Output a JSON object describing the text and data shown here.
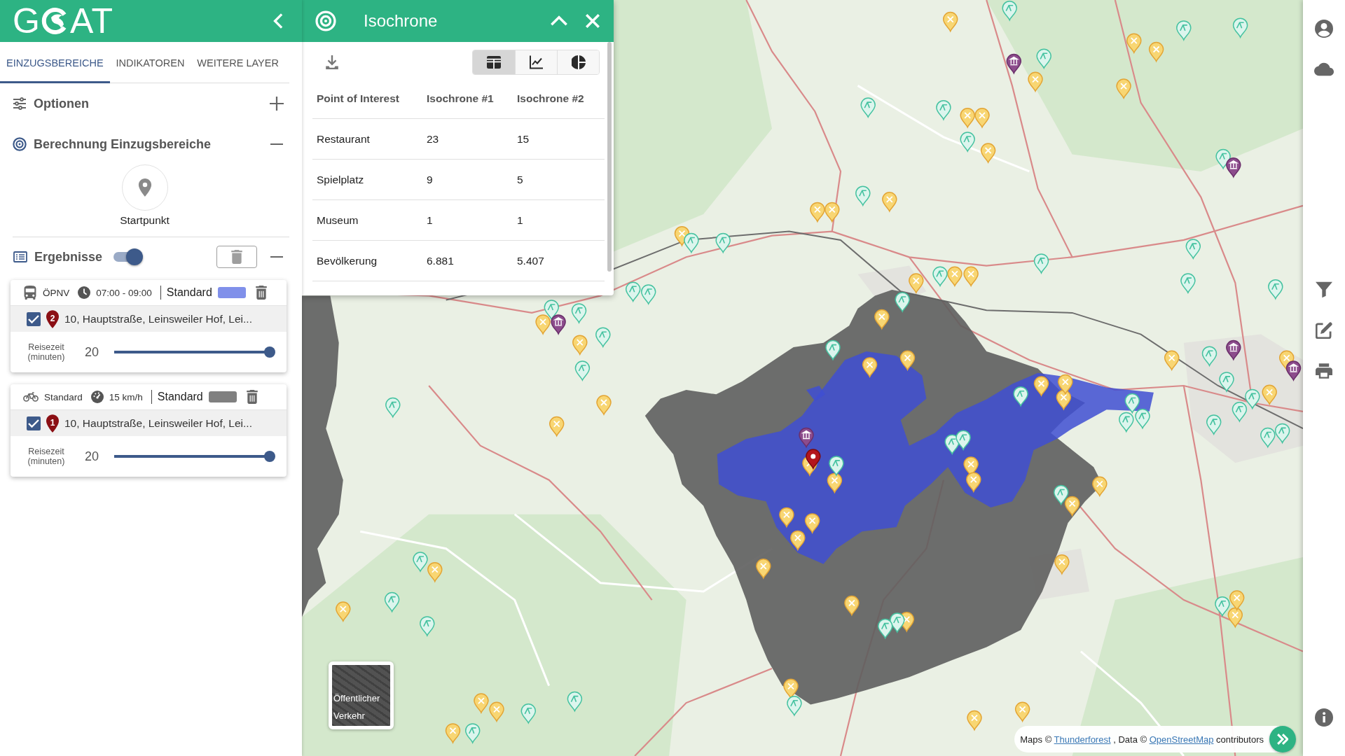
{
  "sidebar": {
    "logo": {
      "before": "G",
      "after": "AT"
    },
    "tabs": [
      {
        "label": "EINZUGSBEREICHE",
        "selected": true
      },
      {
        "label": "INDIKATOREN",
        "selected": false
      },
      {
        "label": "WEITERE LAYER",
        "selected": false
      }
    ],
    "sections": [
      {
        "kind": "options",
        "title": "Optionen",
        "expanded": false
      },
      {
        "kind": "calculation",
        "title": "Berechnung Einzugsbereiche",
        "expanded": true,
        "start_point": "Startpunkt"
      }
    ],
    "results": {
      "title": "Ergebnisse",
      "on": true,
      "expanded": true,
      "cards": [
        {
          "mode": {
            "kind": "transit",
            "label": "ÖPNV"
          },
          "setting": {
            "kind": "time",
            "text": "07:00 - 09:00"
          },
          "profile": "Standard",
          "color": "#8090ea",
          "checked": true,
          "pin": "2",
          "address": "10, Hauptstraße, Leinsweiler Hof, Lei...",
          "travel_label": "Reisezeit (minuten)",
          "travel_value": "20",
          "level": 1
        },
        {
          "mode": {
            "kind": "bike",
            "label": "Standard"
          },
          "setting": {
            "kind": "speed",
            "text": "15 km/h"
          },
          "profile": "Standard",
          "color": "#808080",
          "checked": true,
          "pin": "1",
          "address": "10, Hauptstraße, Leinsweiler Hof, Lei...",
          "travel_label": "Reisezeit (minuten)",
          "travel_value": "20",
          "level": 1
        }
      ]
    }
  },
  "panel": {
    "title": "Isochrone",
    "views": [
      {
        "kind": "table",
        "selected": true
      },
      {
        "kind": "line",
        "selected": false
      },
      {
        "kind": "pie",
        "selected": false
      }
    ],
    "table": {
      "columns": [
        "Point of Interest",
        "Isochrone #1",
        "Isochrone #2"
      ],
      "rows": [
        [
          "Restaurant",
          "23",
          "15"
        ],
        [
          "Spielplatz",
          "9",
          "5"
        ],
        [
          "Museum",
          "1",
          "1"
        ],
        [
          "Bevölkerung",
          "6.881",
          "5.407"
        ]
      ]
    }
  },
  "map": {
    "layer_thumbnail": "Öffentlicher Verkehr",
    "attribution": [
      {
        "kind": "text",
        "text": "Maps ©"
      },
      {
        "kind": "link",
        "text": "Thunderforest"
      },
      {
        "kind": "text",
        "text": ", Data ©"
      },
      {
        "kind": "link",
        "text": "OpenStreetMap"
      },
      {
        "kind": "text",
        "text": "contributors"
      }
    ]
  }
}
